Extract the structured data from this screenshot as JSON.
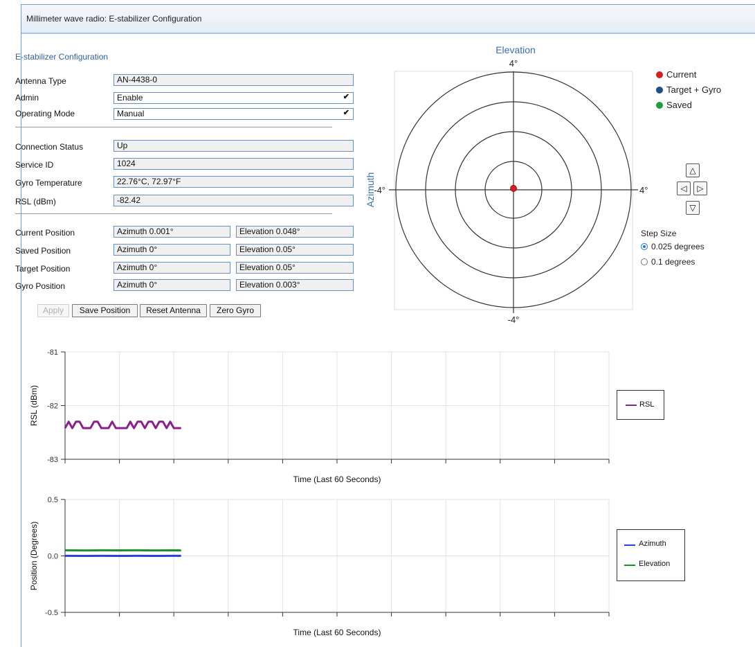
{
  "window": {
    "title": "Millimeter wave radio: E-stabilizer Configuration"
  },
  "config": {
    "section_title": "E-stabilizer Configuration",
    "antenna_type": {
      "label": "Antenna Type",
      "value": "AN-4438-0"
    },
    "admin": {
      "label": "Admin",
      "value": "Enable"
    },
    "operating_mode": {
      "label": "Operating Mode",
      "value": "Manual"
    },
    "connection_status": {
      "label": "Connection Status",
      "value": "Up"
    },
    "service_id": {
      "label": "Service ID",
      "value": "1024"
    },
    "gyro_temperature": {
      "label": "Gyro Temperature",
      "value": "22.76°C, 72.97°F"
    },
    "rsl": {
      "label": "RSL (dBm)",
      "value": "-82.42"
    },
    "positions": [
      {
        "label": "Current Position",
        "azimuth": "Azimuth 0.001°",
        "elevation": "Elevation 0.048°"
      },
      {
        "label": "Saved Position",
        "azimuth": "Azimuth 0°",
        "elevation": "Elevation 0.05°"
      },
      {
        "label": "Target Position",
        "azimuth": "Azimuth 0°",
        "elevation": "Elevation 0.05°"
      },
      {
        "label": "Gyro Position",
        "azimuth": "Azimuth 0°",
        "elevation": "Elevation 0.003°"
      }
    ],
    "buttons": {
      "apply": "Apply",
      "save_position": "Save Position",
      "reset_antenna": "Reset Antenna",
      "zero_gyro": "Zero Gyro"
    }
  },
  "polar": {
    "title": "Elevation",
    "side_label": "Azimuth",
    "top": "4°",
    "bottom": "-4°",
    "left": "-4°",
    "right": "4°",
    "current_point": {
      "azimuth": 0.001,
      "elevation": 0.048
    }
  },
  "legend": {
    "current": {
      "label": "Current",
      "color": "#d32020"
    },
    "target_gyro": {
      "label": "Target + Gyro",
      "color": "#1f4e8c"
    },
    "saved": {
      "label": "Saved",
      "color": "#1f9d3a"
    }
  },
  "controls": {
    "up_icon": "triangle-up-icon",
    "left_icon": "triangle-left-icon",
    "right_icon": "triangle-right-icon",
    "down_icon": "triangle-down-icon",
    "step_size_label": "Step Size",
    "options": [
      {
        "label": "0.025 degrees",
        "selected": true
      },
      {
        "label": "0.1 degrees",
        "selected": false
      }
    ]
  },
  "chart_data": [
    {
      "type": "line",
      "title": "",
      "xlabel": "Time (Last 60 Seconds)",
      "ylabel": "RSL (dBm)",
      "ylim": [
        -83,
        -81
      ],
      "yticks": [
        "-81",
        "-82",
        "-83"
      ],
      "xlim": [
        0,
        60
      ],
      "grid": true,
      "legend_position": "right",
      "series": [
        {
          "name": "RSL",
          "color": "#8b1f8b",
          "x": [
            0,
            0.4,
            0.8,
            1.2,
            1.6,
            2.0,
            2.4,
            2.8,
            3.2,
            3.6,
            4.0,
            4.4,
            4.8,
            5.2,
            5.6,
            6.0,
            6.4,
            6.8,
            7.2,
            7.6,
            8.0,
            8.4,
            8.8,
            9.2,
            9.6,
            10.0,
            10.4,
            10.8,
            11.2,
            11.6,
            12.0,
            12.4,
            12.8
          ],
          "values": [
            -82.42,
            -82.3,
            -82.42,
            -82.3,
            -82.3,
            -82.42,
            -82.42,
            -82.42,
            -82.3,
            -82.3,
            -82.42,
            -82.42,
            -82.42,
            -82.3,
            -82.42,
            -82.42,
            -82.42,
            -82.42,
            -82.3,
            -82.42,
            -82.3,
            -82.3,
            -82.42,
            -82.3,
            -82.3,
            -82.42,
            -82.3,
            -82.3,
            -82.42,
            -82.3,
            -82.42,
            -82.42,
            -82.42
          ]
        }
      ]
    },
    {
      "type": "line",
      "title": "",
      "xlabel": "Time (Last 60 Seconds)",
      "ylabel": "Position (Degrees)",
      "ylim": [
        -0.5,
        0.5
      ],
      "yticks": [
        "0.5",
        "0.0",
        "-0.5"
      ],
      "xlim": [
        0,
        60
      ],
      "grid": true,
      "legend_position": "right",
      "series": [
        {
          "name": "Azimuth",
          "color": "#2b3fe0",
          "x": [
            0,
            2,
            4,
            6,
            8,
            10,
            12,
            12.8
          ],
          "values": [
            0.001,
            0.0,
            0.001,
            0.0,
            0.001,
            0.0,
            0.001,
            0.001
          ]
        },
        {
          "name": "Elevation",
          "color": "#1f8f2a",
          "x": [
            0,
            2,
            4,
            6,
            8,
            10,
            12,
            12.8
          ],
          "values": [
            0.05,
            0.048,
            0.05,
            0.049,
            0.05,
            0.048,
            0.05,
            0.048
          ]
        }
      ]
    }
  ]
}
